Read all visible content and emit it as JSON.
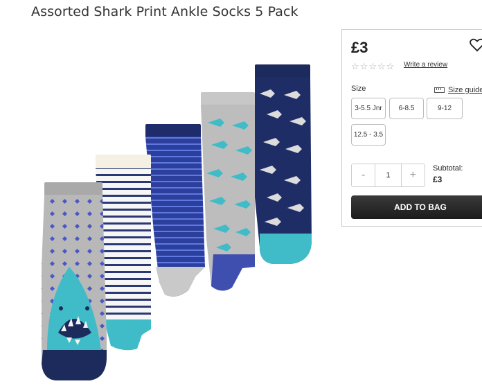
{
  "product": {
    "title": "Assorted Shark Print Ankle Socks 5 Pack",
    "image_alt": "Shark print socks"
  },
  "purchase": {
    "price": "£3",
    "rating_stars": 0,
    "write_review": "Write a review",
    "size_label": "Size",
    "size_guide": "Size guide",
    "sizes": [
      "3-5.5 Jnr",
      "6-8.5",
      "9-12",
      "12.5 - 3.5"
    ],
    "qty_minus": "-",
    "qty_value": "1",
    "qty_plus": "+",
    "subtotal_label": "Subtotal:",
    "subtotal_value": "£3",
    "add_to_bag": "ADD TO BAG"
  },
  "colors": {
    "navy": "#1d2a5c",
    "teal": "#3fbcc7",
    "grey": "#b7b7b7",
    "royal": "#3f4fb0"
  }
}
